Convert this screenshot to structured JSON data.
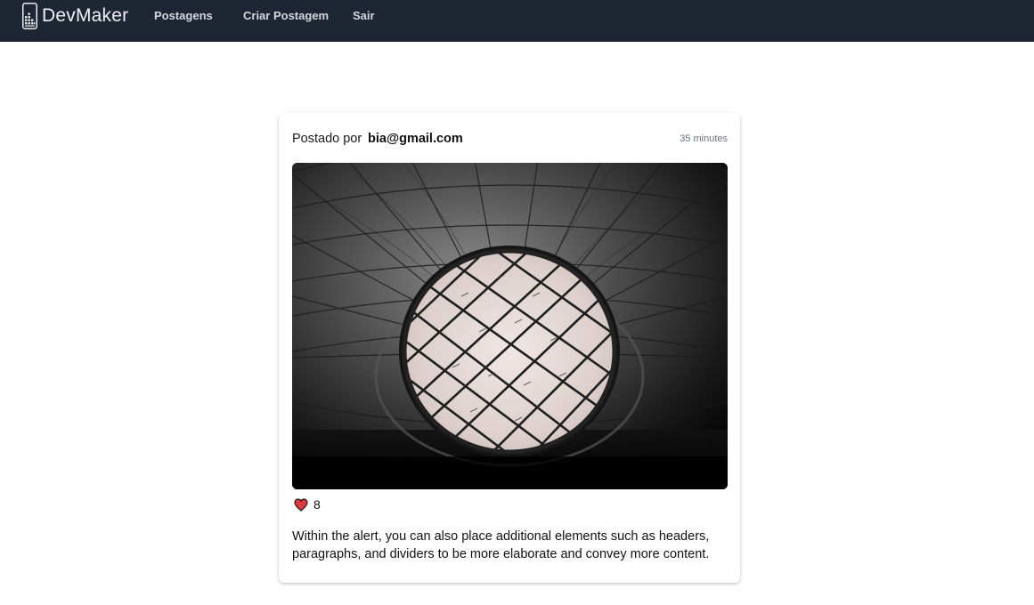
{
  "app": {
    "brand_prefix": "Dev",
    "brand_suffix": "Maker"
  },
  "nav": {
    "items": [
      {
        "label": "Postagens"
      },
      {
        "label": "Criar Postagem"
      },
      {
        "label": "Sair"
      }
    ]
  },
  "post": {
    "posted_by_label": "Postado por",
    "author": "bia@gmail.com",
    "time": "35 minutes",
    "image_icon": "photo-skylight-dome",
    "likes": "8",
    "like_icon": "heart-icon",
    "caption": "Within the alert, you can also place additional elements such as headers, paragraphs, and dividers to be more elaborate and convey more content."
  },
  "colors": {
    "navbar_bg": "#1f2633",
    "heart": "#e0393e"
  }
}
